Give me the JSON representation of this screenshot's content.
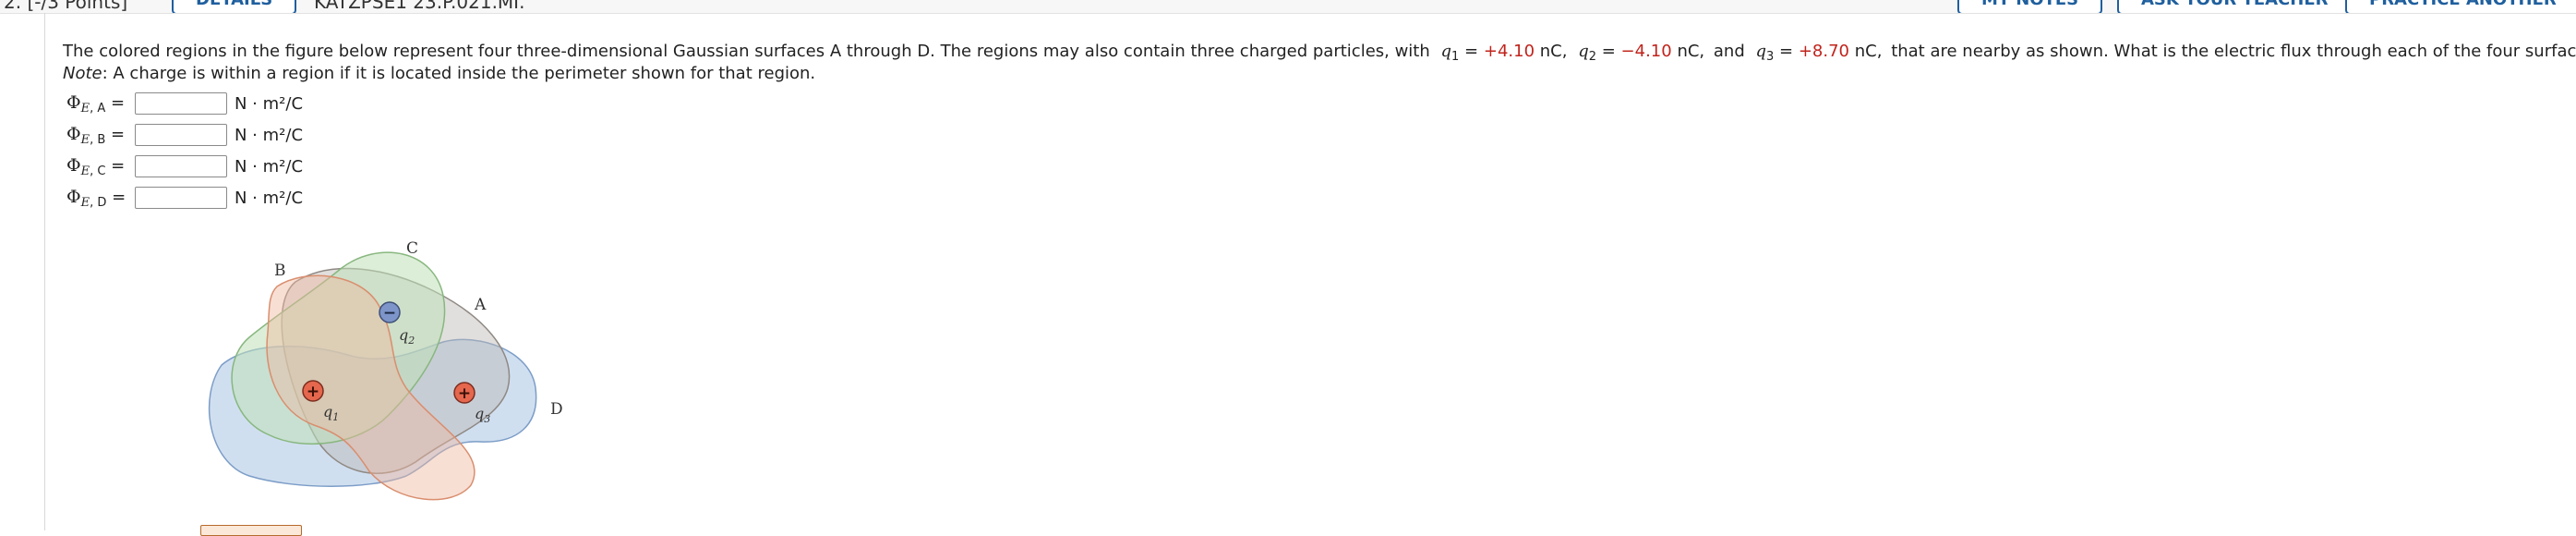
{
  "header": {
    "points_label": "2. [-/3 Points]",
    "details_button": "DETAILS",
    "source": "KATZPSE1 23.P.021.MI.",
    "my_notes_button": "MY NOTES",
    "ask_teacher_button": "ASK YOUR TEACHER",
    "practice_button": "PRACTICE ANOTHER"
  },
  "question": {
    "intro": "The colored regions in the figure below represent four three-dimensional Gaussian surfaces A through D. The regions may also contain three charged particles, with",
    "q1_sym": "q",
    "q1_sub": "1",
    "q1_val": "+4.10",
    "q2_sym": "q",
    "q2_sub": "2",
    "q2_val": "−4.10",
    "q3_sym": "q",
    "q3_sub": "3",
    "q3_val": "+8.70",
    "unit_nc": "nC,",
    "and_word": "and",
    "outro": "that are nearby as shown. What is the electric flux through each of the four surfaces?",
    "note_label": "Note",
    "note_text": ": A charge is within a region if it is located inside the perimeter shown for that region."
  },
  "answers": [
    {
      "label": "A",
      "value": "",
      "unit": "N · m²/C"
    },
    {
      "label": "B",
      "value": "",
      "unit": "N · m²/C"
    },
    {
      "label": "C",
      "value": "",
      "unit": "N · m²/C"
    },
    {
      "label": "D",
      "value": "",
      "unit": "N · m²/C"
    }
  ],
  "figure": {
    "region_labels": [
      "A",
      "B",
      "C",
      "D"
    ],
    "charge_labels": {
      "q1": "q1",
      "q2": "q2",
      "q3": "q3"
    },
    "charge_signs": {
      "q1": "+",
      "q2": "−",
      "q3": "+"
    },
    "colors": {
      "A": "#bdb8b3",
      "B": "#f0b8a0",
      "C": "#bfe0b8",
      "D": "#a9c4e4",
      "positive": "#e5674e",
      "negative": "#7d95c9"
    }
  },
  "colors": {
    "accent_red": "#c0241c",
    "button_blue": "#1f5f9e"
  }
}
